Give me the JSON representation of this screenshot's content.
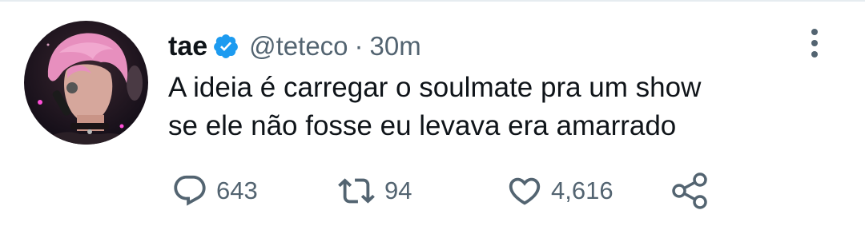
{
  "tweet": {
    "author_name": "tae",
    "author_handle": "@teteco",
    "separator": "·",
    "timestamp": "30m",
    "verified": true,
    "text_lines": [
      "A ideia é carregar o soulmate pra um show",
      "se ele não fosse eu levava era amarrado"
    ],
    "avatar_icon": "profile-photo",
    "accent_color": "#1d9bf0"
  },
  "actions": {
    "reply": {
      "icon": "reply-bubble-icon",
      "count": "643"
    },
    "retweet": {
      "icon": "retweet-icon",
      "count": "94"
    },
    "like": {
      "icon": "heart-icon",
      "count": "4,616"
    },
    "share": {
      "icon": "share-icon"
    }
  },
  "menu": {
    "icon": "more-vertical-icon"
  }
}
